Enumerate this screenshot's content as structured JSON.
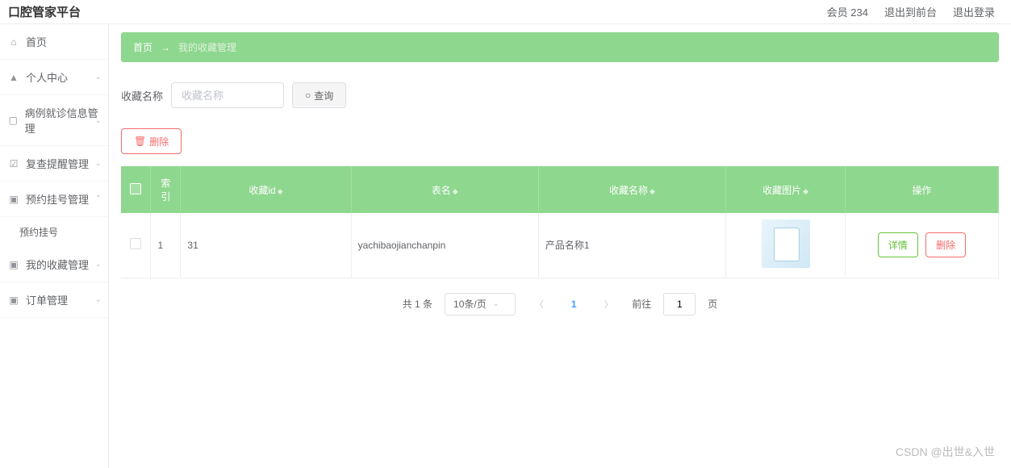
{
  "header": {
    "title": "口腔管家平台",
    "member_label": "会员 234",
    "exit_front": "退出到前台",
    "logout": "退出登录"
  },
  "sidebar": {
    "items": [
      {
        "icon": "home",
        "label": "首页"
      },
      {
        "icon": "user",
        "label": "个人中心",
        "expandable": true
      },
      {
        "icon": "card",
        "label": "病例就诊信息管理",
        "expandable": true
      },
      {
        "icon": "check",
        "label": "复查提醒管理",
        "expandable": true
      },
      {
        "icon": "bag",
        "label": "预约挂号管理",
        "expandable": true,
        "expanded": true,
        "children": [
          {
            "label": "预约挂号"
          }
        ]
      },
      {
        "icon": "bag",
        "label": "我的收藏管理",
        "expandable": true
      },
      {
        "icon": "bag",
        "label": "订单管理",
        "expandable": true
      }
    ]
  },
  "breadcrumb": {
    "home": "首页",
    "arrow": "→",
    "current": "我的收藏管理"
  },
  "filter": {
    "label": "收藏名称",
    "placeholder": "收藏名称",
    "search_btn": "查询"
  },
  "actions": {
    "delete_btn": "删除"
  },
  "table": {
    "headers": {
      "index": "索引",
      "id": "收藏id",
      "table_name": "表名",
      "name": "收藏名称",
      "image": "收藏图片",
      "operation": "操作"
    },
    "rows": [
      {
        "index": "1",
        "id": "31",
        "table_name": "yachibaojianchanpin",
        "name": "产品名称1",
        "detail_btn": "详情",
        "delete_btn": "删除"
      }
    ]
  },
  "pagination": {
    "total": "共 1 条",
    "per_page": "10条/页",
    "current": "1",
    "goto_label": "前往",
    "goto_value": "1",
    "page_suffix": "页"
  },
  "watermark": "CSDN @出世&入世"
}
